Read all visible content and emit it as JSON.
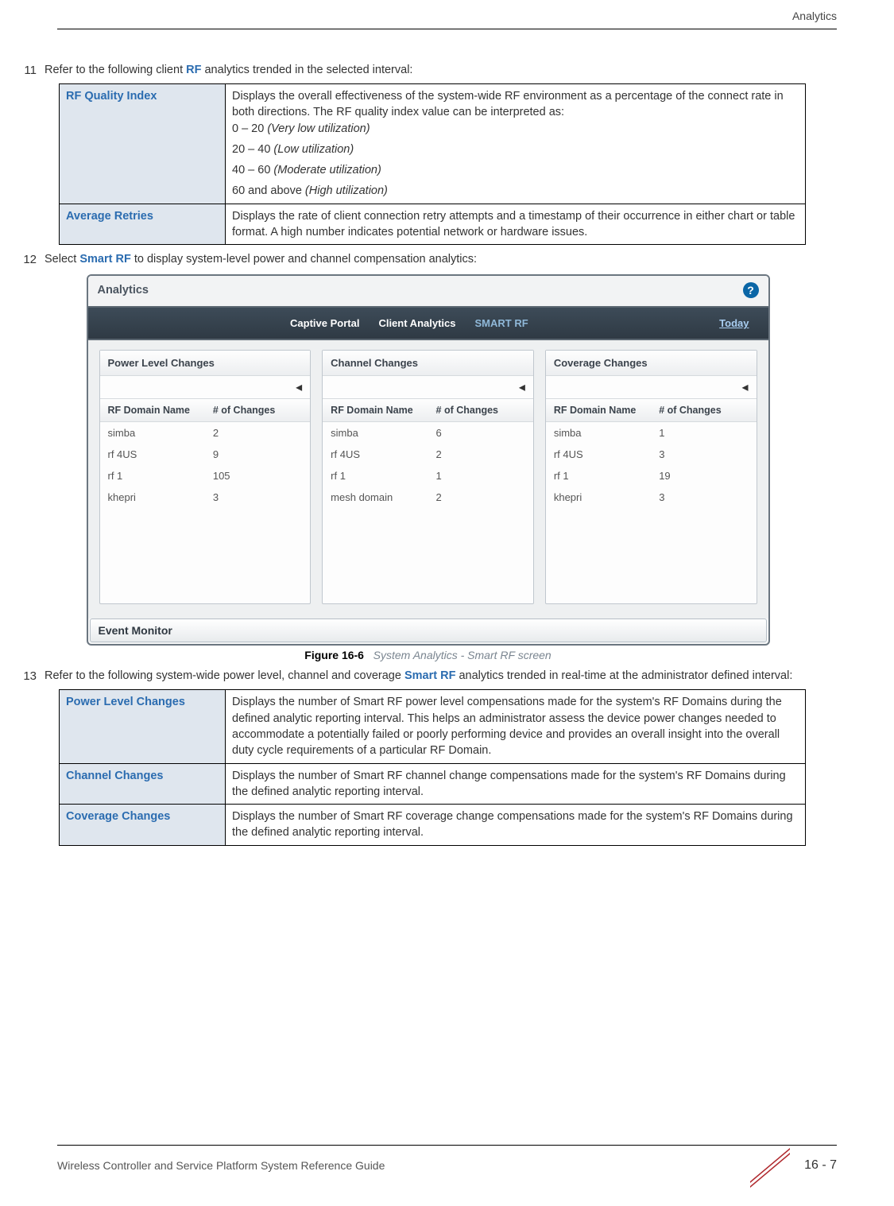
{
  "header": {
    "section": "Analytics"
  },
  "item11": {
    "num": "11",
    "text_pre": "Refer to the following client ",
    "rf": "RF",
    "text_post": " analytics trended in the selected interval:",
    "rows": {
      "r1": {
        "term": "RF Quality Index",
        "p1": "Displays the overall effectiveness of the system-wide RF environment as a percentage of the connect rate in both directions. The RF quality index value can be interpreted as:",
        "l1a": "0 – 20 ",
        "l1b": "(Very low utilization)",
        "l2a": "20 – 40 ",
        "l2b": "(Low utilization)",
        "l3a": "40 – 60 ",
        "l3b": "(Moderate utilization)",
        "l4a": "60 and above ",
        "l4b": "(High utilization)"
      },
      "r2": {
        "term": "Average Retries",
        "desc": "Displays the rate of client connection retry attempts and a timestamp of their occurrence in either chart or table format. A high number indicates potential network or hardware issues."
      }
    }
  },
  "item12": {
    "num": "12",
    "text_pre": "Select ",
    "smart": "Smart RF",
    "text_post": " to display system-level power and channel compensation analytics:"
  },
  "screenshot": {
    "title": "Analytics",
    "help": "?",
    "tabs": {
      "t1": "Captive Portal",
      "t2": "Client Analytics",
      "t3": "SMART RF",
      "today": "Today"
    },
    "col_a": "RF Domain Name",
    "col_b": "# of Changes",
    "arrow": "◂",
    "panel1": {
      "title": "Power Level Changes",
      "rows": [
        {
          "a": "simba",
          "b": "2"
        },
        {
          "a": "rf 4US",
          "b": "9"
        },
        {
          "a": "rf 1",
          "b": "105"
        },
        {
          "a": "khepri",
          "b": "3"
        }
      ]
    },
    "panel2": {
      "title": "Channel Changes",
      "rows": [
        {
          "a": "simba",
          "b": "6"
        },
        {
          "a": "rf 4US",
          "b": "2"
        },
        {
          "a": "rf 1",
          "b": "1"
        },
        {
          "a": "mesh domain",
          "b": "2"
        }
      ]
    },
    "panel3": {
      "title": "Coverage Changes",
      "rows": [
        {
          "a": "simba",
          "b": "1"
        },
        {
          "a": "rf 4US",
          "b": "3"
        },
        {
          "a": "rf 1",
          "b": "19"
        },
        {
          "a": "khepri",
          "b": "3"
        }
      ]
    },
    "event_monitor": "Event Monitor"
  },
  "figure": {
    "label": "Figure 16-6",
    "desc": "System Analytics - Smart RF screen"
  },
  "item13": {
    "num": "13",
    "text_pre": "Refer to the following system-wide power level, channel and coverage ",
    "smart": "Smart RF",
    "text_post": " analytics trended in real-time at the administrator defined interval:",
    "rows": {
      "r1": {
        "term": "Power Level Changes",
        "desc": "Displays the number of Smart RF power level compensations made for the system's RF Domains during the defined analytic reporting interval. This helps an administrator assess the device power changes needed to accommodate a potentially failed or poorly performing device and provides an overall insight into the overall duty cycle requirements of a particular RF Domain."
      },
      "r2": {
        "term": "Channel Changes",
        "desc": "Displays the number of Smart RF channel change compensations made for the system's RF Domains during the defined analytic reporting interval."
      },
      "r3": {
        "term": "Coverage Changes",
        "desc": "Displays the number of Smart RF coverage change compensations made for the system's RF Domains during the defined analytic reporting interval."
      }
    }
  },
  "footer": {
    "left": "Wireless Controller and Service Platform System Reference Guide",
    "right": "16 - 7"
  },
  "chart_data": [
    {
      "type": "table",
      "title": "Power Level Changes",
      "categories": [
        "simba",
        "rf 4US",
        "rf 1",
        "khepri"
      ],
      "values": [
        2,
        9,
        105,
        3
      ]
    },
    {
      "type": "table",
      "title": "Channel Changes",
      "categories": [
        "simba",
        "rf 4US",
        "rf 1",
        "mesh domain"
      ],
      "values": [
        6,
        2,
        1,
        2
      ]
    },
    {
      "type": "table",
      "title": "Coverage Changes",
      "categories": [
        "simba",
        "rf 4US",
        "rf 1",
        "khepri"
      ],
      "values": [
        1,
        3,
        19,
        3
      ]
    }
  ]
}
